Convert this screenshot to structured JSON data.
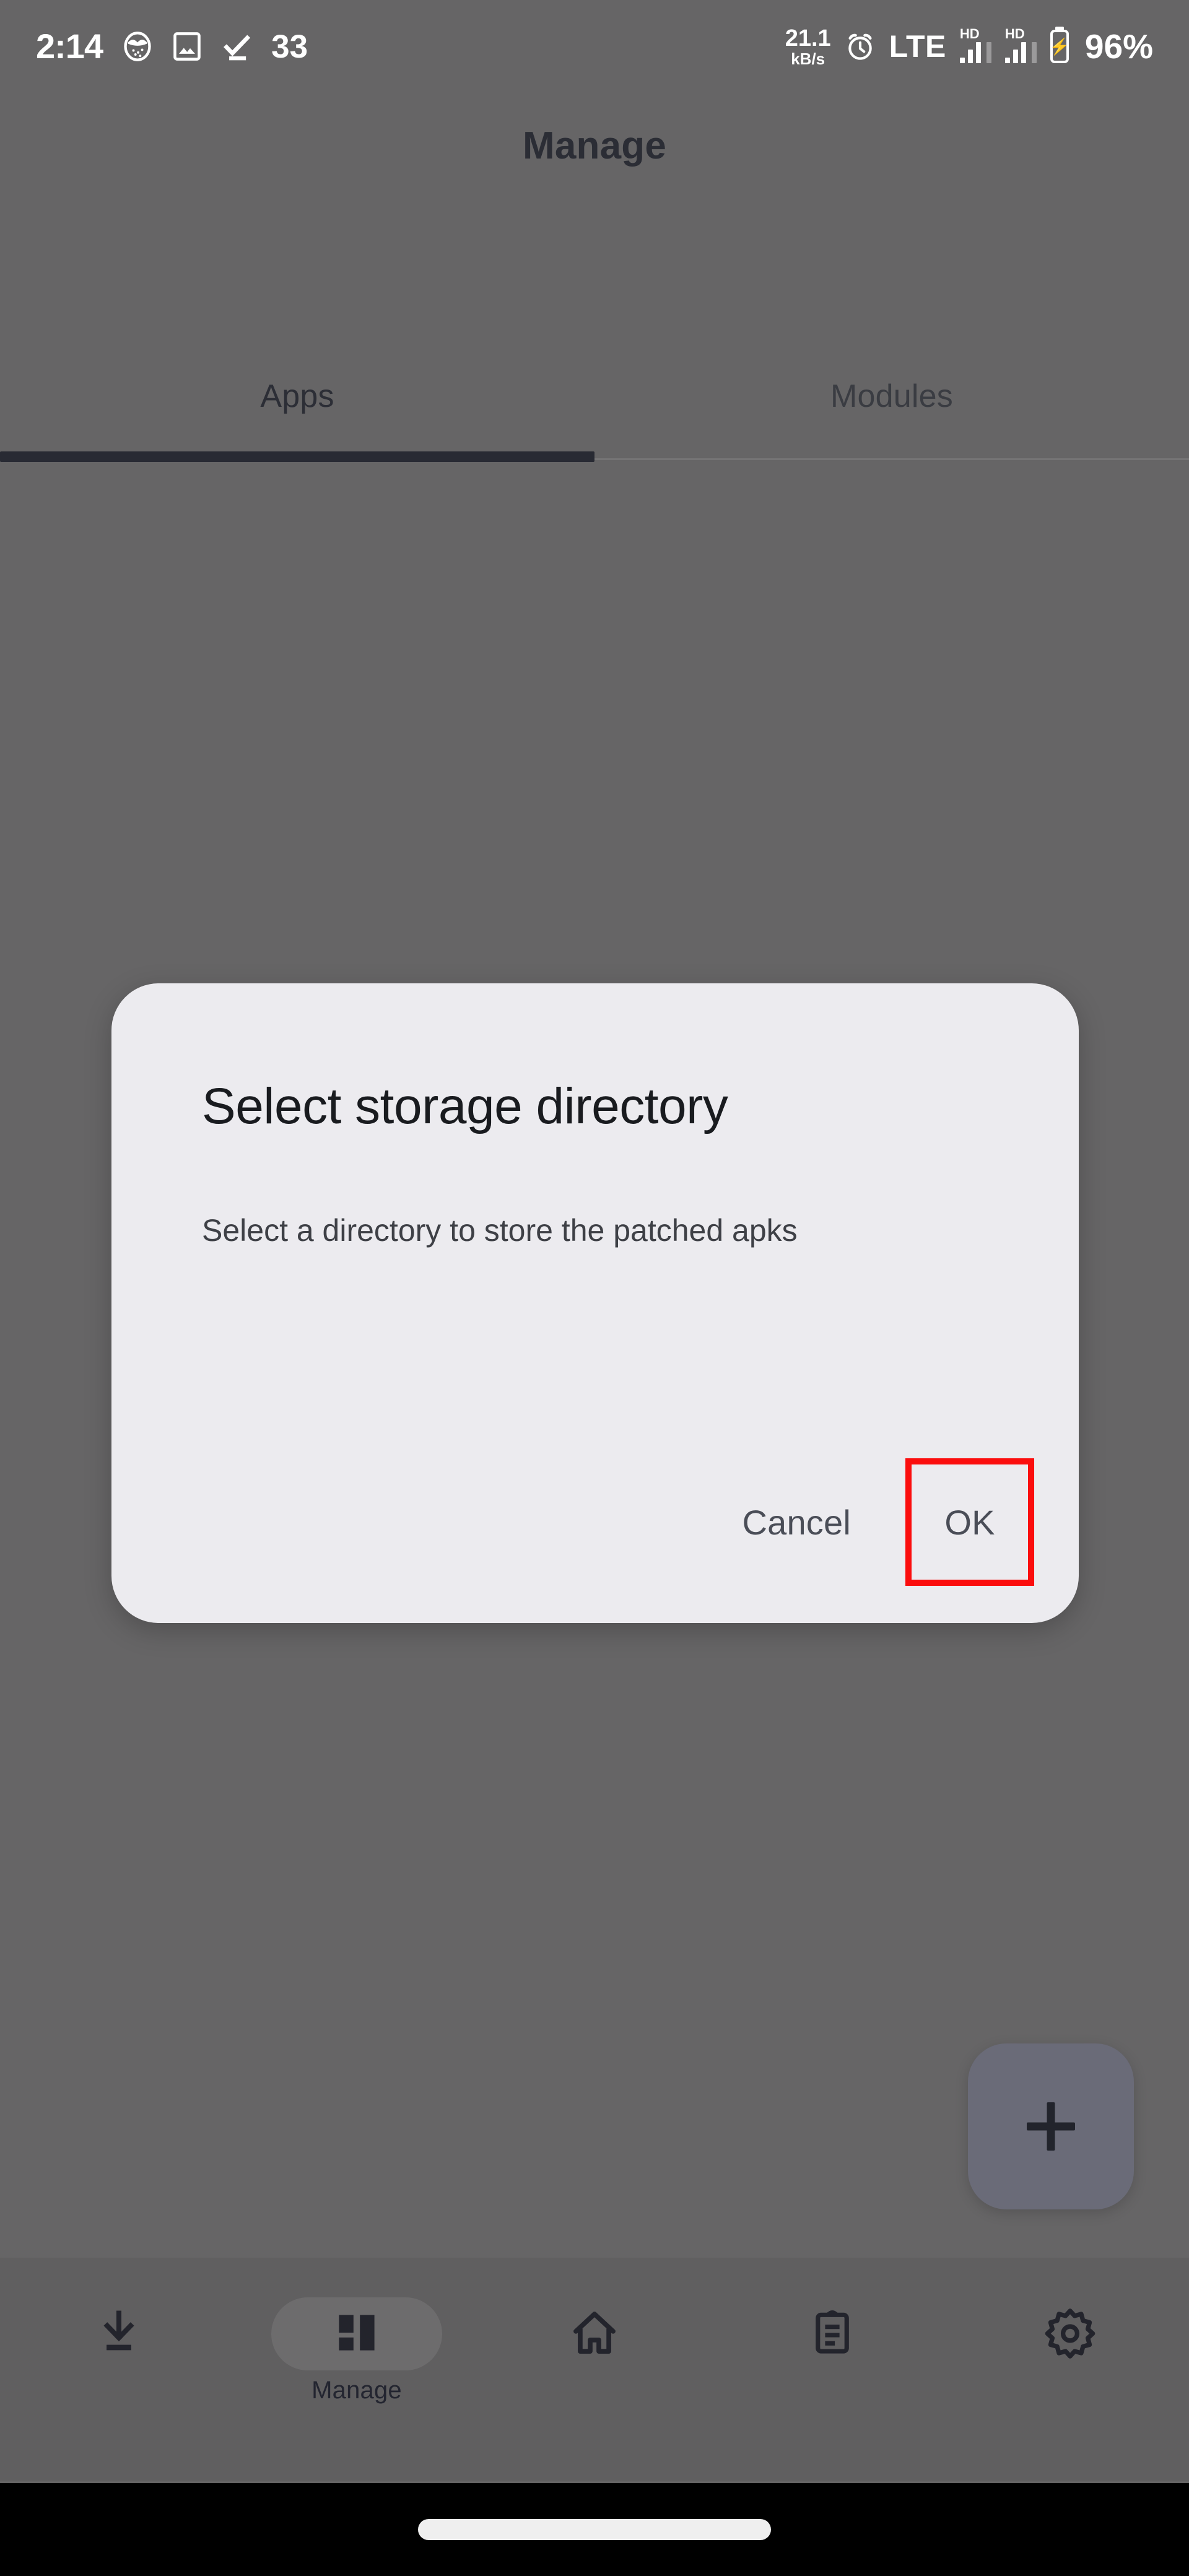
{
  "status_bar": {
    "time": "2:14",
    "notification_count": "33",
    "network_speed_value": "21.1",
    "network_speed_unit": "kB/s",
    "network_type": "LTE",
    "sim1_label": "HD",
    "sim2_label": "HD",
    "battery_percent": "96%",
    "icons": [
      "app-circle-icon",
      "photo-icon",
      "download-done-icon",
      "alarm-icon",
      "signal-icon",
      "battery-charging-icon"
    ]
  },
  "app_bar": {
    "title": "Manage"
  },
  "tabs": {
    "items": [
      {
        "label": "Apps",
        "selected": true
      },
      {
        "label": "Modules",
        "selected": false
      }
    ]
  },
  "fab": {
    "icon": "plus-icon",
    "color": "#6a6b78"
  },
  "bottom_nav": {
    "items": [
      {
        "label": "",
        "icon": "download-icon",
        "selected": false
      },
      {
        "label": "Manage",
        "icon": "dashboard-icon",
        "selected": true
      },
      {
        "label": "",
        "icon": "home-icon",
        "selected": false
      },
      {
        "label": "",
        "icon": "clipboard-icon",
        "selected": false
      },
      {
        "label": "",
        "icon": "settings-gear-icon",
        "selected": false
      }
    ]
  },
  "dialog": {
    "title": "Select storage directory",
    "body": "Select a directory to store the patched apks",
    "cancel_label": "Cancel",
    "ok_label": "OK",
    "highlight_color": "#fb0d0d",
    "background_color": "#ecebef"
  },
  "scrim": {
    "color": "#666566"
  }
}
